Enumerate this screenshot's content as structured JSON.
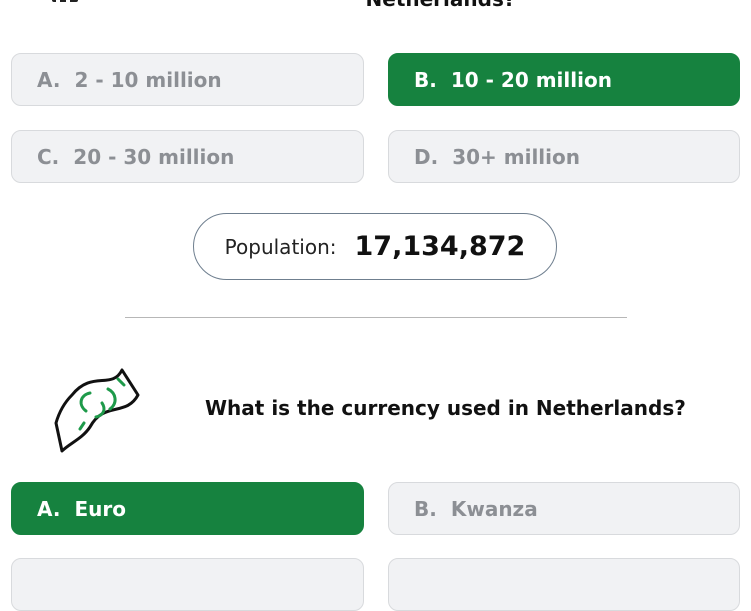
{
  "previous_question": {
    "title_fragment": "Netherlands?",
    "options": [
      {
        "letter": "A.",
        "text": "2 - 10 million",
        "state": "neutral"
      },
      {
        "letter": "B.",
        "text": "10 - 20 million",
        "state": "correct"
      },
      {
        "letter": "C.",
        "text": "20 - 30 million",
        "state": "neutral"
      },
      {
        "letter": "D.",
        "text": "30+ million",
        "state": "neutral"
      }
    ],
    "result": {
      "label": "Population:",
      "value": "17,134,872"
    }
  },
  "current_question": {
    "icon": "money-bill-icon",
    "text": "What is the currency used in Netherlands?",
    "options": [
      {
        "letter": "A.",
        "text": "Euro",
        "state": "correct"
      },
      {
        "letter": "B.",
        "text": "Kwanza",
        "state": "neutral"
      }
    ]
  },
  "colors": {
    "correct": "#16823f",
    "neutral_bg": "#f1f2f4",
    "neutral_text": "#8c8f94"
  }
}
